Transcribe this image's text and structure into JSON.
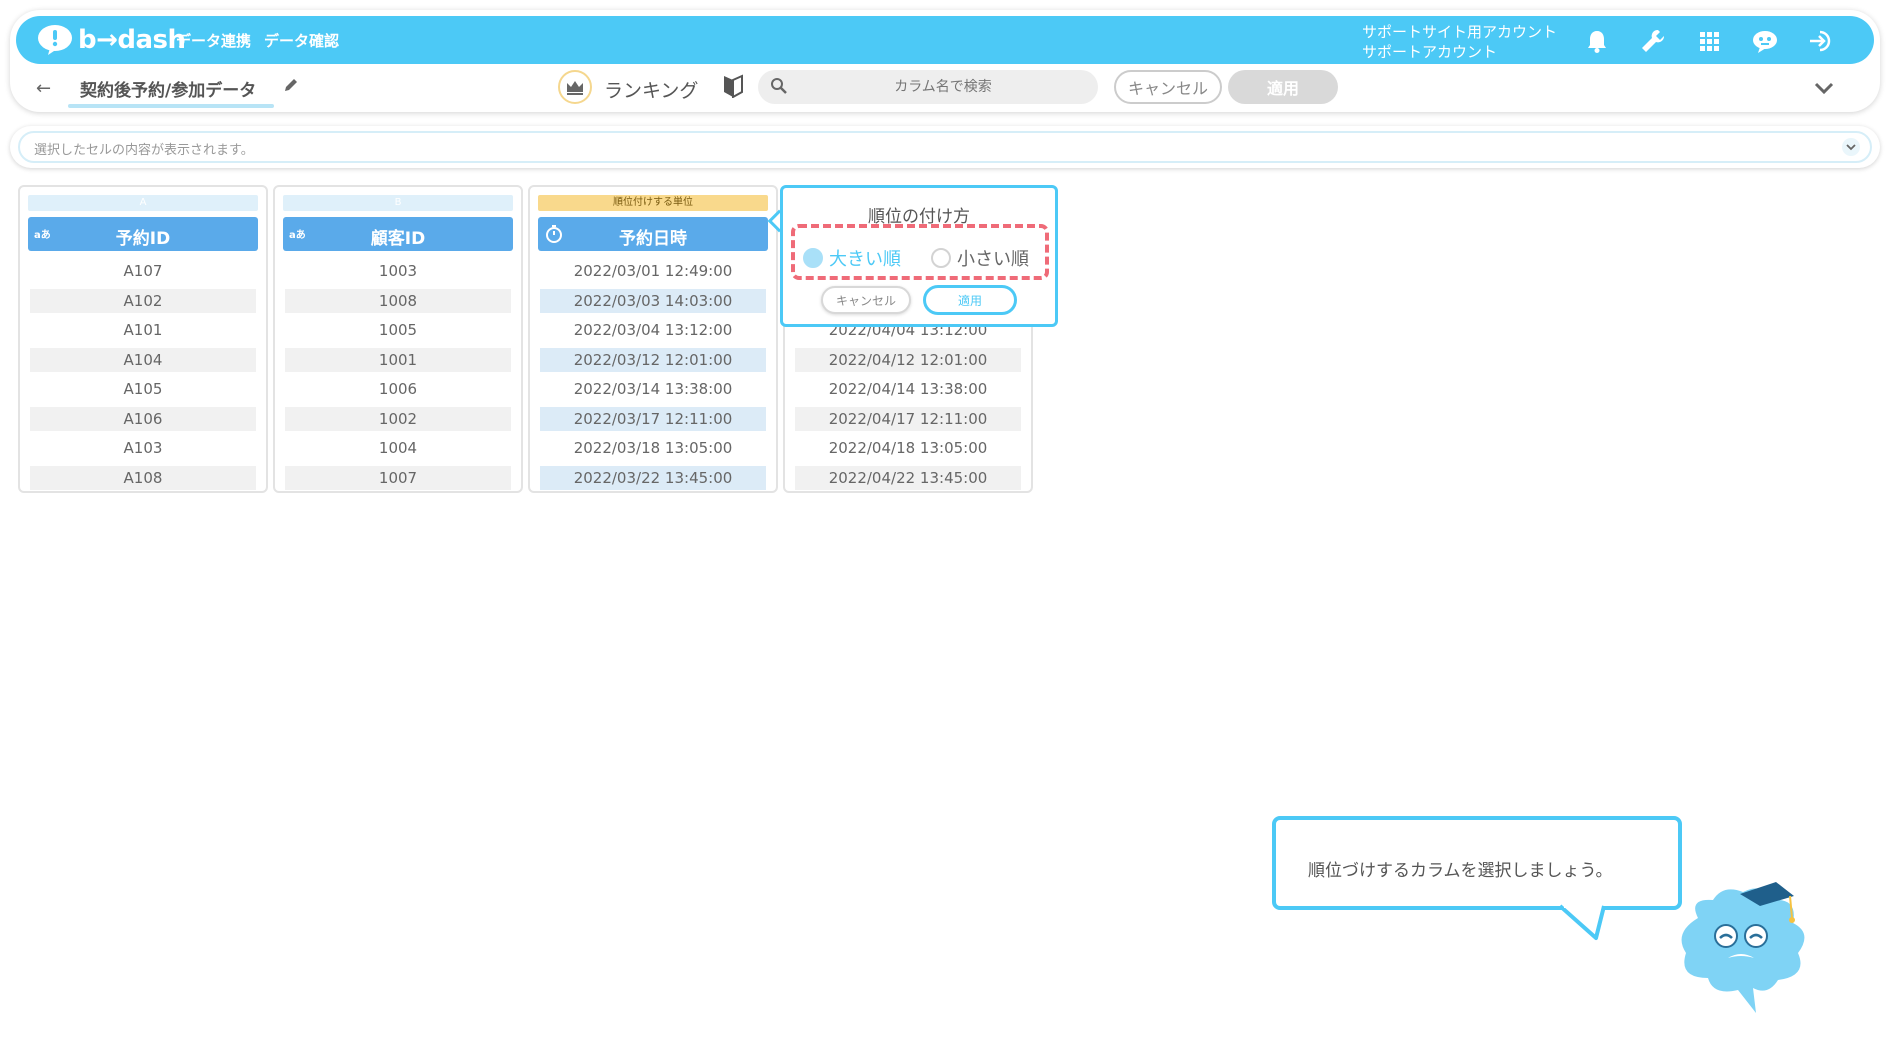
{
  "header": {
    "logo_text": "b→dash",
    "nav": [
      "データ連携",
      "データ確認"
    ],
    "account_line1": "サポートサイト用アカウント",
    "account_line2": "サポートアカウント",
    "icons": [
      "bell-icon",
      "wrench-icon",
      "grid-icon",
      "chat-icon",
      "logout-icon"
    ]
  },
  "toolbar": {
    "back_label": "←",
    "data_title": "契約後予約/参加データ",
    "mode_label": "ランキング",
    "search_placeholder": "カラム名で検索",
    "cancel_label": "キャンセル",
    "apply_label": "適用"
  },
  "cell_bar": {
    "placeholder": "選択したセルの内容が表示されます。"
  },
  "columns": [
    {
      "letter": "A",
      "type": "aあ",
      "name": "予約ID",
      "values": [
        "A107",
        "A102",
        "A101",
        "A104",
        "A105",
        "A106",
        "A103",
        "A108"
      ]
    },
    {
      "letter": "B",
      "type": "aあ",
      "name": "顧客ID",
      "values": [
        "1003",
        "1008",
        "1005",
        "1001",
        "1006",
        "1002",
        "1004",
        "1007"
      ]
    },
    {
      "letter": "順位付けする単位",
      "type": "timer",
      "name": "予約日時",
      "values": [
        "2022/03/01 12:49:00",
        "2022/03/03 14:03:00",
        "2022/03/04 13:12:00",
        "2022/03/12 12:01:00",
        "2022/03/14 13:38:00",
        "2022/03/17 12:11:00",
        "2022/03/18 13:05:00",
        "2022/03/22 13:45:00"
      ]
    },
    {
      "values": [
        "2022/04/04 13:12:00",
        "2022/04/12 12:01:00",
        "2022/04/14 13:38:00",
        "2022/04/17 12:11:00",
        "2022/04/18 13:05:00",
        "2022/04/22 13:45:00"
      ]
    }
  ],
  "popover": {
    "title": "順位の付け方",
    "option_desc": "大きい順",
    "option_asc": "小さい順",
    "selected": "desc",
    "cancel_label": "キャンセル",
    "apply_label": "適用"
  },
  "guide": {
    "message": "順位づけするカラムを選択しましょう。"
  },
  "colors": {
    "brand": "#4cc9f6",
    "column_header": "#5aaaea",
    "ranking_unit": "#f9d98c",
    "highlight_dash": "#ef6b78"
  }
}
